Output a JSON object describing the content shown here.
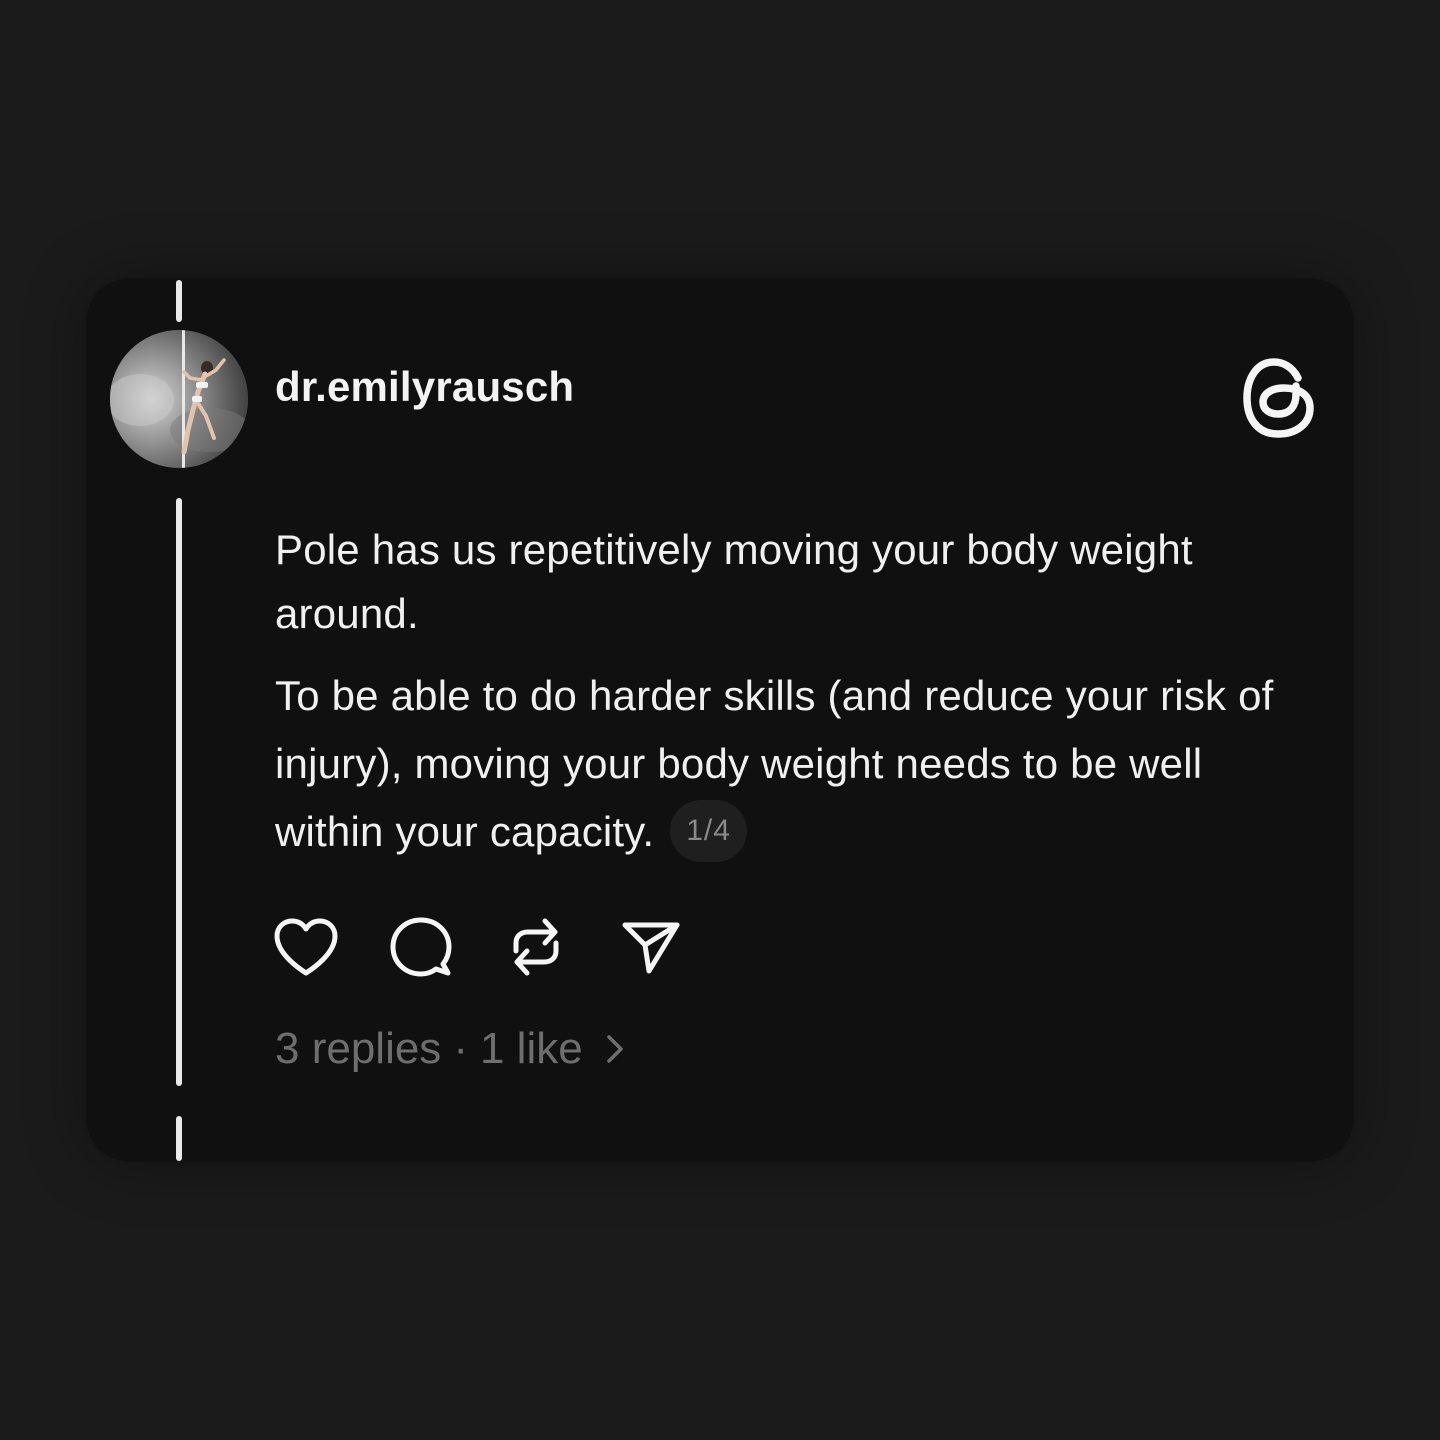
{
  "post": {
    "username": "dr.emilyrausch",
    "paragraph_1": "Pole has us repetitively moving your body weight around.",
    "paragraph_2": "To be able to do harder skills (and reduce your risk of injury), moving your body weight needs to be well within your capacity.",
    "page_indicator": "1/4",
    "replies": "3 replies",
    "separator": "·",
    "likes": "1 like"
  },
  "icons": {
    "logo": "threads-logo-icon",
    "like": "heart-icon",
    "reply": "comment-bubble-icon",
    "repost": "repost-icon",
    "share": "send-icon",
    "more": "chevron-right-icon"
  },
  "colors": {
    "background": "#1b1b1b",
    "card": "#101010",
    "text_primary": "#f0f0f0",
    "text_secondary": "#6e6e6e",
    "badge_bg": "#1f1f1f"
  }
}
